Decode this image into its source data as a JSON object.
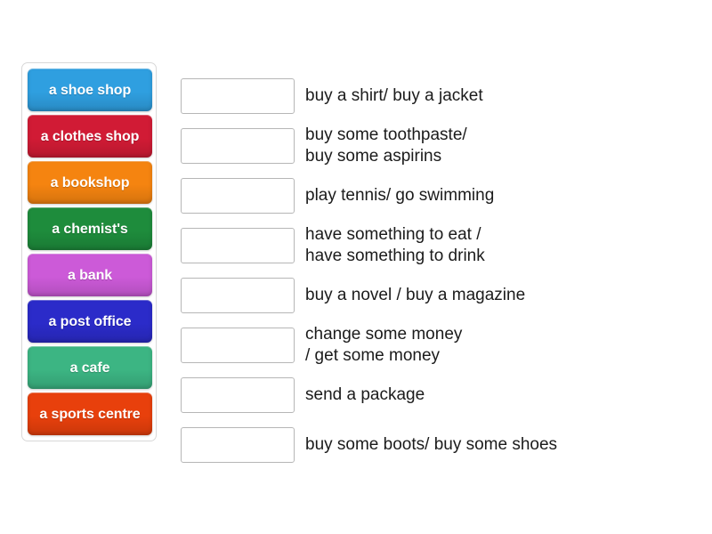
{
  "activity": {
    "type": "match-up",
    "tray": {
      "tiles": [
        {
          "label": "a shoe shop",
          "color": "#2f9fe0"
        },
        {
          "label": "a clothes shop",
          "color": "#d11b35"
        },
        {
          "label": "a bookshop",
          "color": "#f58410"
        },
        {
          "label": "a chemist's",
          "color": "#1e8c3c"
        },
        {
          "label": "a bank",
          "color": "#cc5ad8"
        },
        {
          "label": "a post office",
          "color": "#2b2bc9"
        },
        {
          "label": "a cafe",
          "color": "#3cb583"
        },
        {
          "label": "a sports centre",
          "color": "#e8400c"
        }
      ]
    },
    "prompts": [
      {
        "answer": "",
        "text": "buy a shirt/ buy a jacket"
      },
      {
        "answer": "",
        "text": "buy some toothpaste/\nbuy some aspirins"
      },
      {
        "answer": "",
        "text": "play tennis/ go swimming"
      },
      {
        "answer": "",
        "text": "have something to eat /\nhave something to drink"
      },
      {
        "answer": "",
        "text": "buy a novel / buy a magazine"
      },
      {
        "answer": "",
        "text": "change some money\n/ get some money"
      },
      {
        "answer": "",
        "text": "send a package"
      },
      {
        "answer": "",
        "text": "buy some boots/ buy some shoes"
      }
    ]
  }
}
